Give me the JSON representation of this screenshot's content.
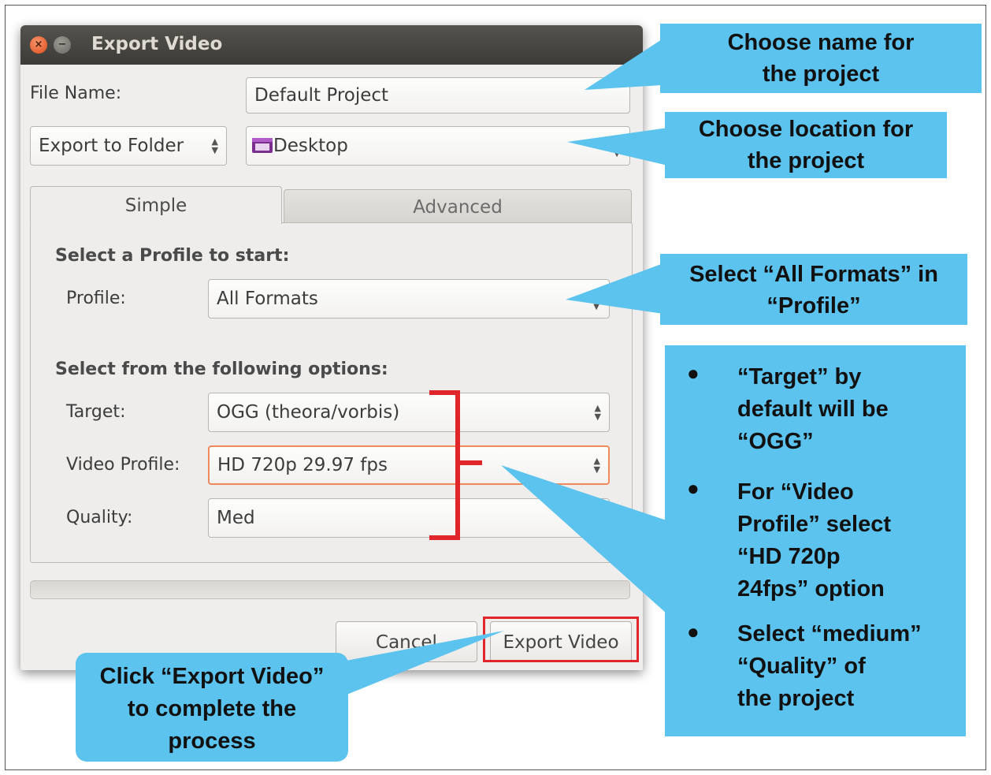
{
  "dialog": {
    "title": "Export Video",
    "file_name_label": "File Name:",
    "file_name_value": "Default Project",
    "export_mode": "Export to Folder",
    "folder": "Desktop",
    "tabs": [
      "Simple",
      "Advanced"
    ],
    "profile_heading": "Select a Profile to start:",
    "profile_label": "Profile:",
    "profile_value": "All Formats",
    "options_heading": "Select from the following options:",
    "target_label": "Target:",
    "target_value": "OGG (theora/vorbis)",
    "video_profile_label": "Video Profile:",
    "video_profile_value": "HD 720p 29.97 fps",
    "quality_label": "Quality:",
    "quality_value": "Med",
    "cancel_label": "Cancel",
    "export_label": "Export Video"
  },
  "callouts": {
    "name_line1": "Choose name for",
    "name_line2": "the project",
    "location_line1": "Choose location for",
    "location_line2": "the project",
    "profile_line1": "Select “All Formats” in",
    "profile_line2": "“Profile”",
    "bullets": [
      [
        "“Target” by",
        "default will be",
        "“OGG”"
      ],
      [
        "For “Video",
        "Profile” select",
        "“HD 720p",
        "24fps” option"
      ],
      [
        "Select “medium”",
        "“Quality” of",
        "the project"
      ]
    ],
    "export_line1": "Click “Export Video”",
    "export_line2": "to complete the",
    "export_line3": "process"
  },
  "colors": {
    "callout": "#5bc3ee",
    "highlight": "#e0262a",
    "titlebar": "#3c3b37"
  }
}
